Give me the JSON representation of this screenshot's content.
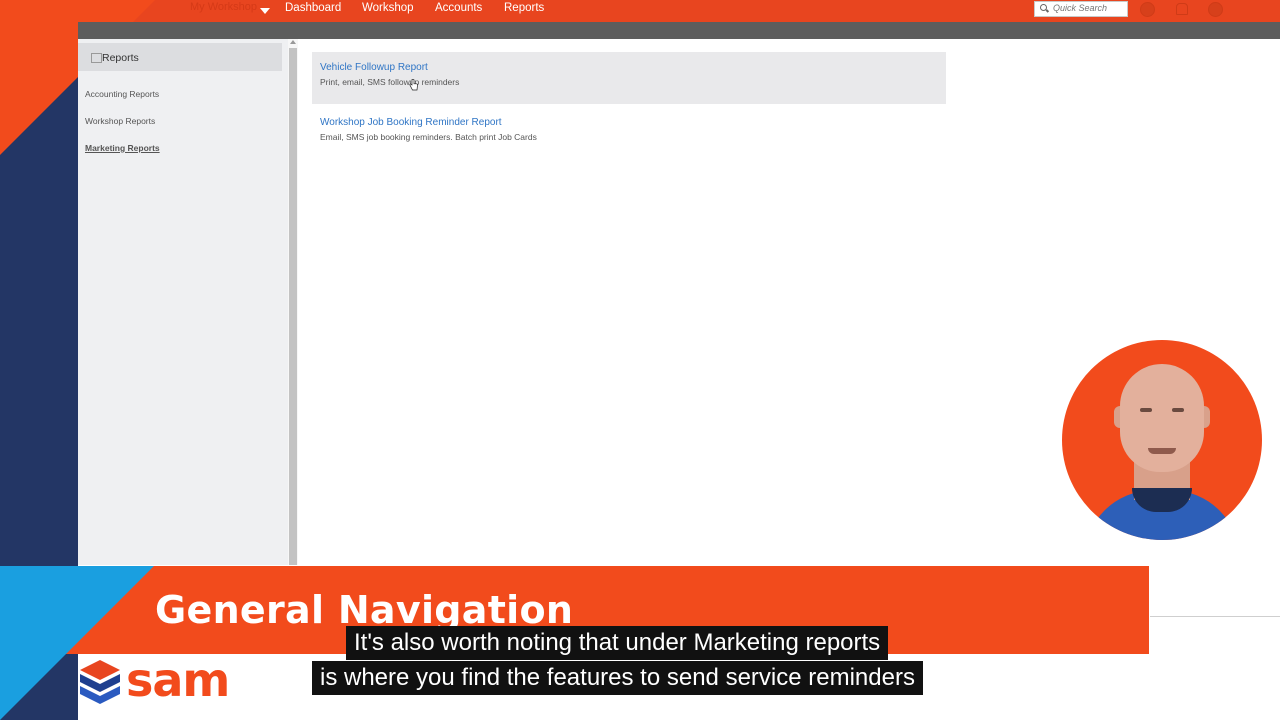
{
  "nav": {
    "hub_label": "My Workshop",
    "items": [
      "Dashboard",
      "Workshop",
      "Accounts",
      "Reports"
    ],
    "search_placeholder": "Quick Search"
  },
  "sidebar": {
    "title": "Reports",
    "links": [
      "Accounting Reports",
      "Workshop Reports",
      "Marketing Reports"
    ]
  },
  "reports": [
    {
      "title": "Vehicle Followup Report",
      "desc": "Print, email, SMS followup reminders"
    },
    {
      "title": "Workshop Job Booking Reminder Report",
      "desc": "Email, SMS job booking reminders. Batch print Job Cards"
    }
  ],
  "banner": {
    "title": "General Navigation"
  },
  "brand": {
    "name": "sam"
  },
  "captions": [
    "It's also worth noting that under Marketing reports",
    "is where you find the features to send service reminders"
  ],
  "colors": {
    "accent": "#f24b1c",
    "navy": "#233665",
    "link": "#2f75c5",
    "blue": "#1a9fe0"
  }
}
